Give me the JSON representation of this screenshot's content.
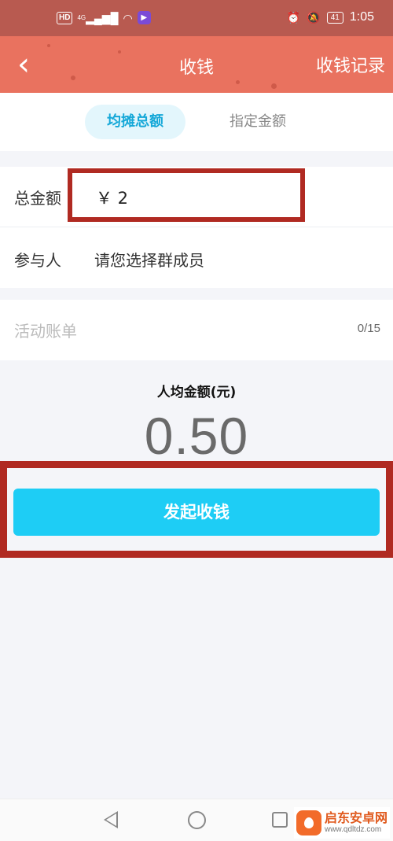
{
  "status_bar": {
    "hd": "HD",
    "network": "4G",
    "time": "1:05",
    "battery": "41"
  },
  "header": {
    "title": "收钱",
    "record_link": "收钱记录",
    "background_color": "#e9725f"
  },
  "tabs": [
    {
      "label": "均摊总额",
      "active": true
    },
    {
      "label": "指定金额",
      "active": false
    }
  ],
  "form": {
    "amount_label": "总金额",
    "amount_value": "￥ 2",
    "people_label": "参与人",
    "people_placeholder": "请您选择群成员",
    "bill_placeholder": "活动账单",
    "bill_count": "0/15"
  },
  "summary": {
    "avg_label": "人均金额(元)",
    "avg_value": "0.50"
  },
  "action": {
    "button_label": "发起收钱",
    "button_color": "#1ecdf5"
  },
  "annotations": {
    "highlight_color": "#b02a22"
  },
  "watermark": {
    "name": "启东安卓网",
    "url": "www.qdltdz.com"
  }
}
